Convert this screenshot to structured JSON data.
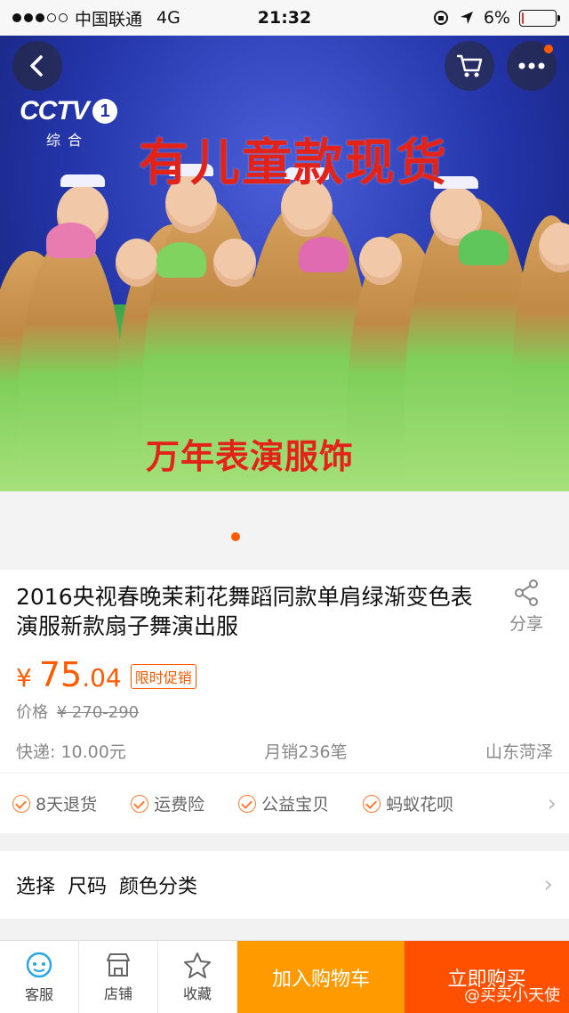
{
  "status_bar": {
    "carrier": "中国联通",
    "network": "4G",
    "time": "21:32",
    "battery": "6%",
    "battery_level": 0.06
  },
  "hero": {
    "logo_text": "CCTV",
    "logo_channel": "1",
    "logo_sub": "综合",
    "headline": "有儿童款现货",
    "caption": "万年表演服饰",
    "slide_index": 1,
    "slide_count": 1
  },
  "product": {
    "title": "2016央视春晚茉莉花舞蹈同款单肩绿渐变色表演服新款扇子舞演出服",
    "share_label": "分享",
    "price_symbol": "¥",
    "price_int": "75",
    "price_dec": ".04",
    "promo_tag": "限时促销",
    "orig_price_label": "价格",
    "orig_price": "¥ 270-290",
    "shipping": "快递: 10.00元",
    "monthly_sales": "月销236笔",
    "location": "山东菏泽"
  },
  "services": [
    {
      "label": "8天退货"
    },
    {
      "label": "运费险"
    },
    {
      "label": "公益宝贝"
    },
    {
      "label": "蚂蚁花呗"
    }
  ],
  "select": {
    "label": "选择",
    "size": "尺码",
    "color": "颜色分类"
  },
  "bottom_bar": {
    "service": "客服",
    "shop": "店铺",
    "favorite": "收藏",
    "add_to_cart": "加入购物车",
    "buy_now": "立即购买",
    "watermark": "@买买小天使"
  },
  "colors": {
    "accent": "#ff5a00",
    "cart_button": "#ff9a00",
    "buy_button": "#ff5000"
  }
}
